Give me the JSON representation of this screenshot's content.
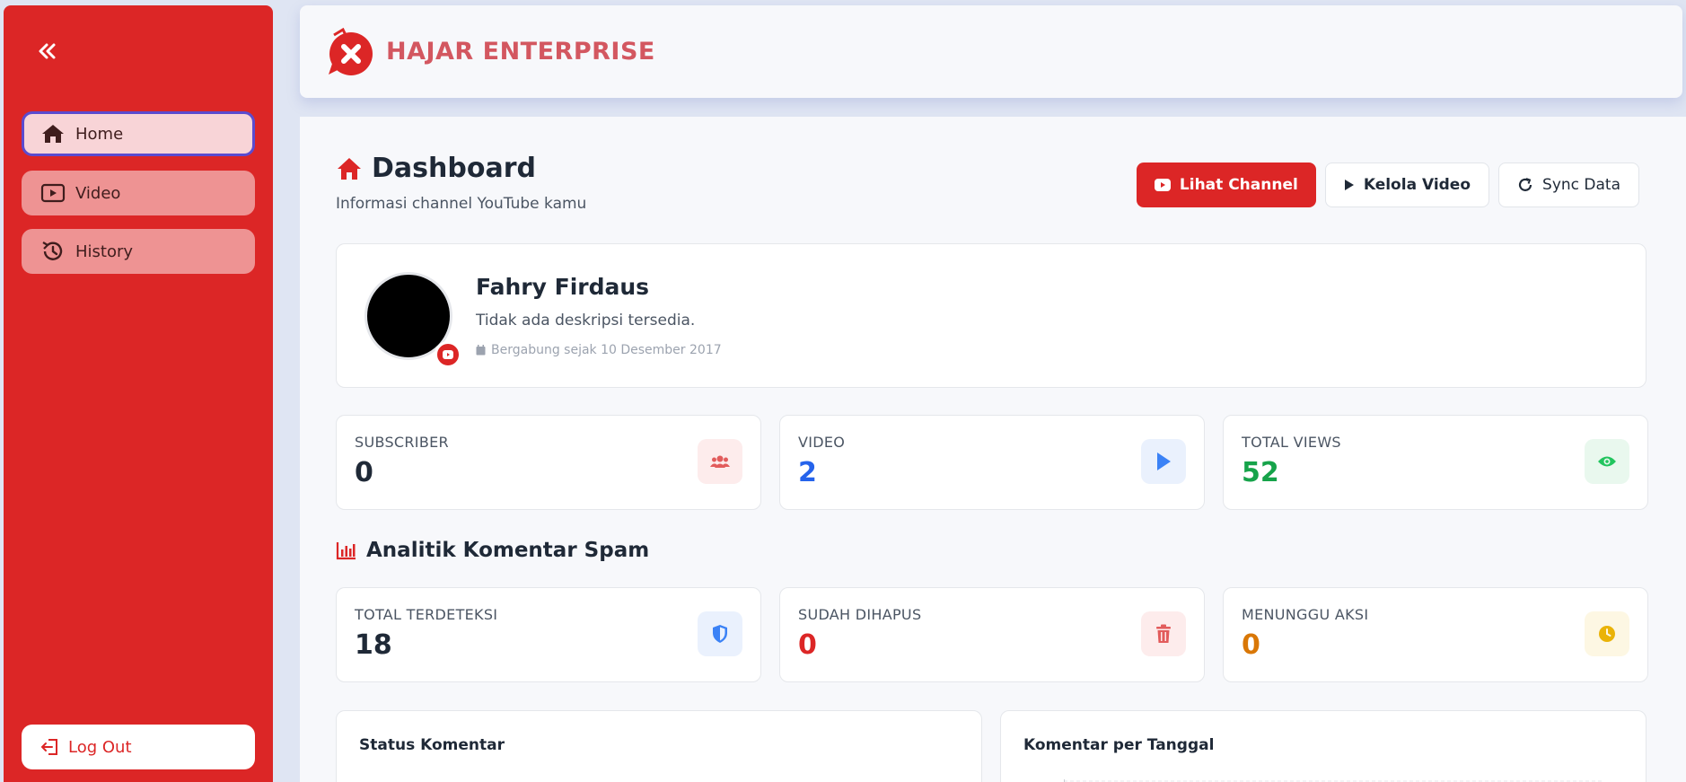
{
  "sidebar": {
    "items": [
      {
        "label": "Home",
        "icon": "home-icon",
        "active": true
      },
      {
        "label": "Video",
        "icon": "play-square-icon",
        "active": false
      },
      {
        "label": "History",
        "icon": "history-icon",
        "active": false
      }
    ],
    "logout_label": "Log Out"
  },
  "header": {
    "brand": "HAJAR ENTERPRISE"
  },
  "page": {
    "title": "Dashboard",
    "subtitle": "Informasi channel YouTube kamu",
    "actions": {
      "view_channel": "Lihat Channel",
      "manage_video": "Kelola Video",
      "sync": "Sync Data"
    }
  },
  "profile": {
    "name": "Fahry Firdaus",
    "description": "Tidak ada deskripsi tersedia.",
    "joined": "Bergabung sejak 10 Desember 2017"
  },
  "stats": [
    {
      "label": "SUBSCRIBER",
      "value": "0",
      "color": "#1f2937",
      "icon": "users-icon",
      "badge_bg": "#fdecec",
      "icon_color": "#e25c5c"
    },
    {
      "label": "VIDEO",
      "value": "2",
      "color": "#2563eb",
      "icon": "play-icon",
      "badge_bg": "#eaf1fd",
      "icon_color": "#3b82f6"
    },
    {
      "label": "TOTAL VIEWS",
      "value": "52",
      "color": "#16a34a",
      "icon": "eye-icon",
      "badge_bg": "#e9f8ee",
      "icon_color": "#22c55e"
    }
  ],
  "spam_section": {
    "title": "Analitik Komentar Spam",
    "stats": [
      {
        "label": "TOTAL TERDETEKSI",
        "value": "18",
        "color": "#1f2937",
        "icon": "shield-icon",
        "badge_bg": "#eaf1fd",
        "icon_color": "#3b82f6"
      },
      {
        "label": "SUDAH DIHAPUS",
        "value": "0",
        "color": "#dc2626",
        "icon": "trash-icon",
        "badge_bg": "#fdecec",
        "icon_color": "#e25c5c"
      },
      {
        "label": "MENUNGGU AKSI",
        "value": "0",
        "color": "#d97706",
        "icon": "clock-icon",
        "badge_bg": "#fdf7e3",
        "icon_color": "#eab308"
      }
    ]
  },
  "charts": {
    "status_title": "Status Komentar",
    "per_date_title": "Komentar per Tanggal"
  }
}
